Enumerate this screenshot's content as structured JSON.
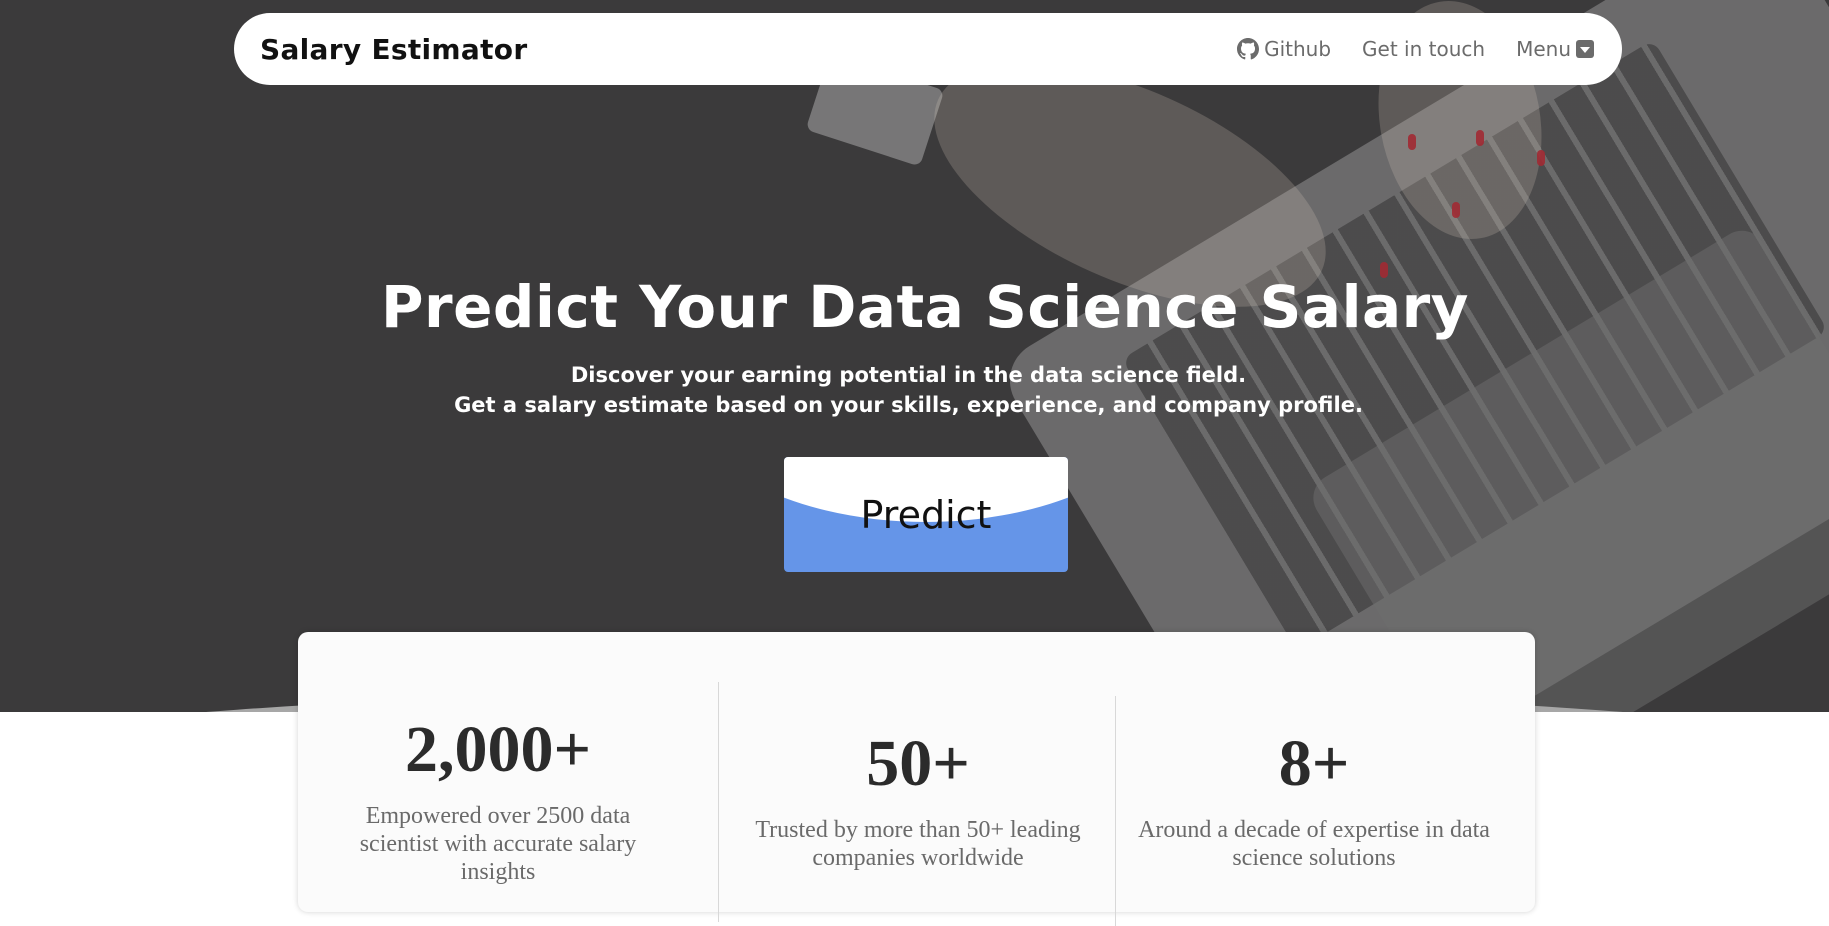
{
  "nav": {
    "brand": "Salary Estimator",
    "links": [
      {
        "label": "Github",
        "icon": "github-icon"
      },
      {
        "label": "Get in touch"
      },
      {
        "label": "Menu",
        "icon": "caret-down-icon"
      }
    ]
  },
  "hero": {
    "title": "Predict Your Data Science Salary",
    "subtitle_line1": "Discover your earning potential in the data science field.",
    "subtitle_line2": "Get a salary estimate based on your skills, experience, and company profile.",
    "cta_label": "Predict",
    "cta_color": "#6595e8"
  },
  "stats": [
    {
      "value": "2,000+",
      "description": "Empowered over 2500 data scientist with accurate salary insights"
    },
    {
      "value": "50+",
      "description": "Trusted by more than 50+ leading companies worldwide"
    },
    {
      "value": "8+",
      "description": "Around a decade of expertise in data science solutions"
    }
  ]
}
